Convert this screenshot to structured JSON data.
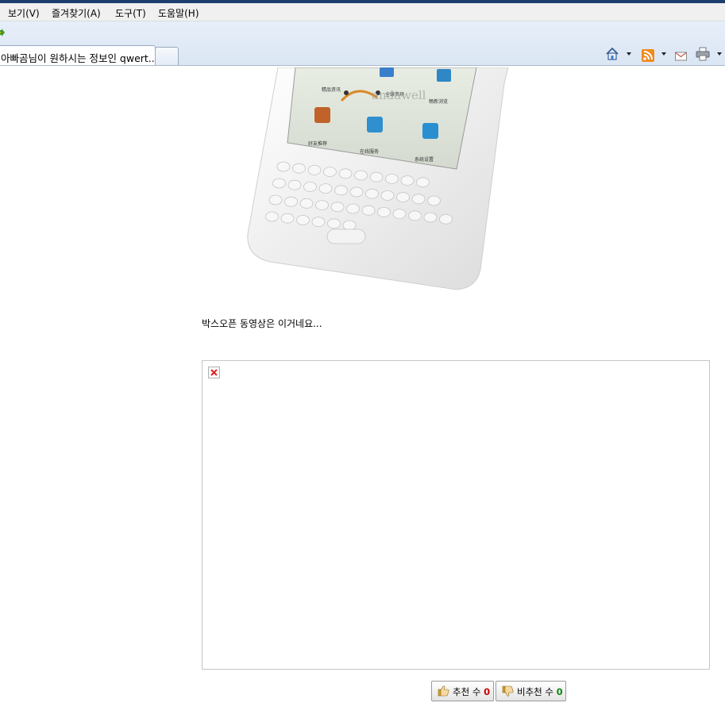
{
  "menubar": {
    "items": [
      "보기(V)",
      "즐겨찾기(A)",
      "도구(T)",
      "도움말(H)"
    ]
  },
  "tabs": {
    "active_title": "아빠곰님이 원하시는 정보인 qwert..."
  },
  "toolbar": {
    "icons": [
      "home-icon",
      "rss-feed-icon",
      "mail-icon",
      "print-icon"
    ]
  },
  "article": {
    "device_labels": [
      "精品资讯",
      "全球市场",
      "畅新浏览",
      "好友推荐",
      "在线服务",
      "系统设置"
    ],
    "device_logo": "andawell",
    "caption": "박스오픈 동영상은 이거네요..."
  },
  "votes": {
    "recommend_label": "추천 수",
    "recommend_count": "0",
    "recommend_color": "#cc0000",
    "not_recommend_label": "비추천 수",
    "not_recommend_count": "0",
    "not_recommend_color": "#118811"
  }
}
